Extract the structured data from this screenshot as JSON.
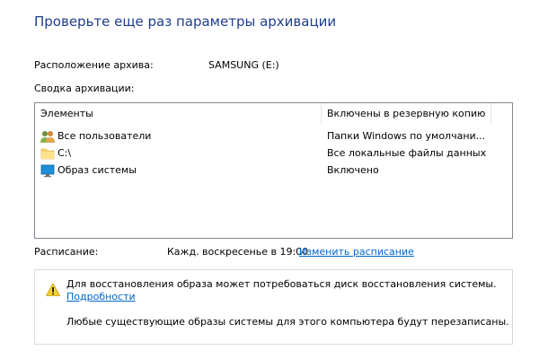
{
  "title": "Проверьте еще раз параметры архивации",
  "location": {
    "label": "Расположение архива:",
    "value": "SAMSUNG (E:)"
  },
  "summary": {
    "label": "Сводка архивации:",
    "columns": [
      "Элементы",
      "Включены в резервную копию"
    ],
    "items": [
      {
        "name": "Все пользователи",
        "included": "Папки Windows по умолчани...",
        "icon": "users-icon"
      },
      {
        "name": "C:\\",
        "included": "Все локальные файлы данных",
        "icon": "folder-icon"
      },
      {
        "name": "Образ системы",
        "included": "Включено",
        "icon": "monitor-icon"
      }
    ]
  },
  "schedule": {
    "label": "Расписание:",
    "value": "Кажд. воскресенье в 19:00",
    "link": "Изменить расписание"
  },
  "warning": {
    "icon": "warning-icon",
    "text": "Для восстановления образа может потребоваться диск восстановления системы.",
    "link": "Подробности",
    "note": "Любые существующие образы системы для этого компьютера будут перезаписаны."
  }
}
